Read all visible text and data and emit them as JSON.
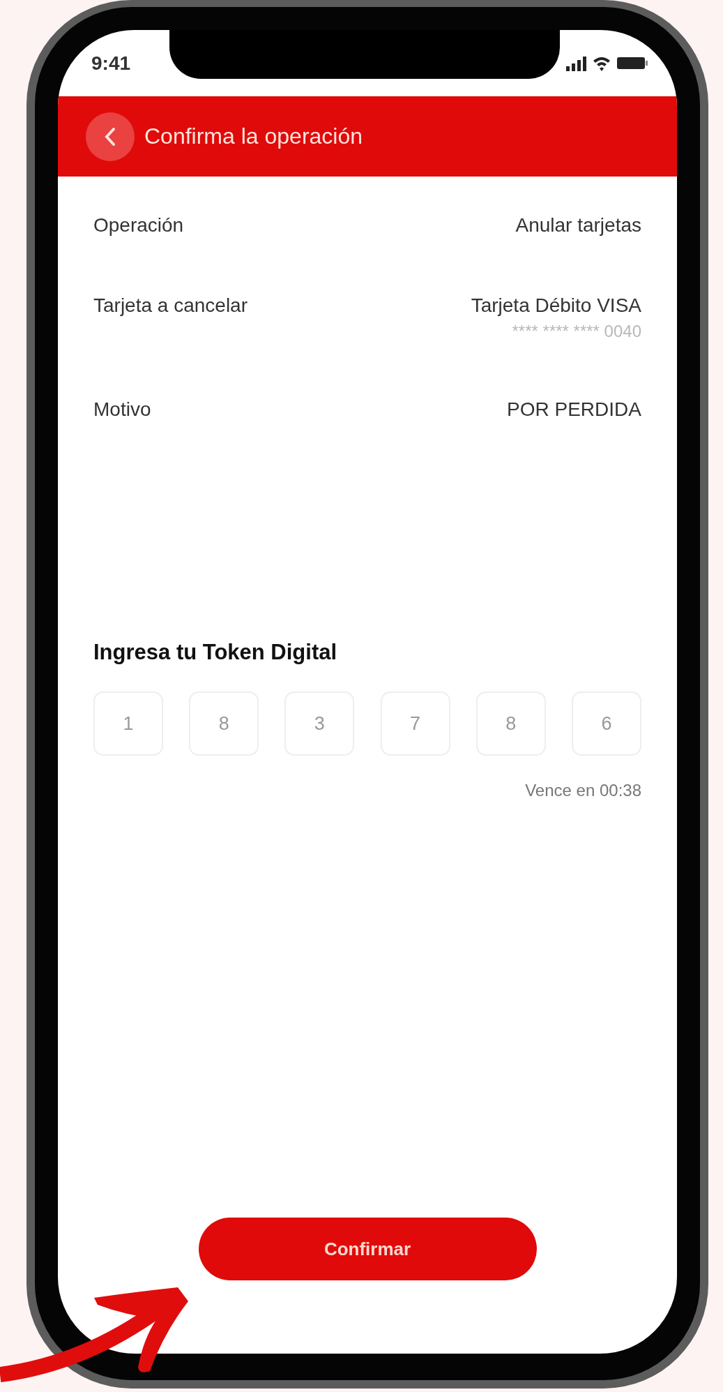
{
  "status_bar": {
    "time": "9:41"
  },
  "header": {
    "title": "Confirma la operación"
  },
  "details": [
    {
      "label": "Operación",
      "value": "Anular tarjetas"
    },
    {
      "label": "Tarjeta a cancelar",
      "value": "Tarjeta Débito VISA",
      "sub": "**** **** **** 0040"
    },
    {
      "label": "Motivo",
      "value": "POR PERDIDA"
    }
  ],
  "token": {
    "title": "Ingresa tu Token Digital",
    "digits": [
      "1",
      "8",
      "3",
      "7",
      "8",
      "6"
    ],
    "expiry": "Vence en 00:38"
  },
  "button": {
    "label": "Confirmar"
  }
}
